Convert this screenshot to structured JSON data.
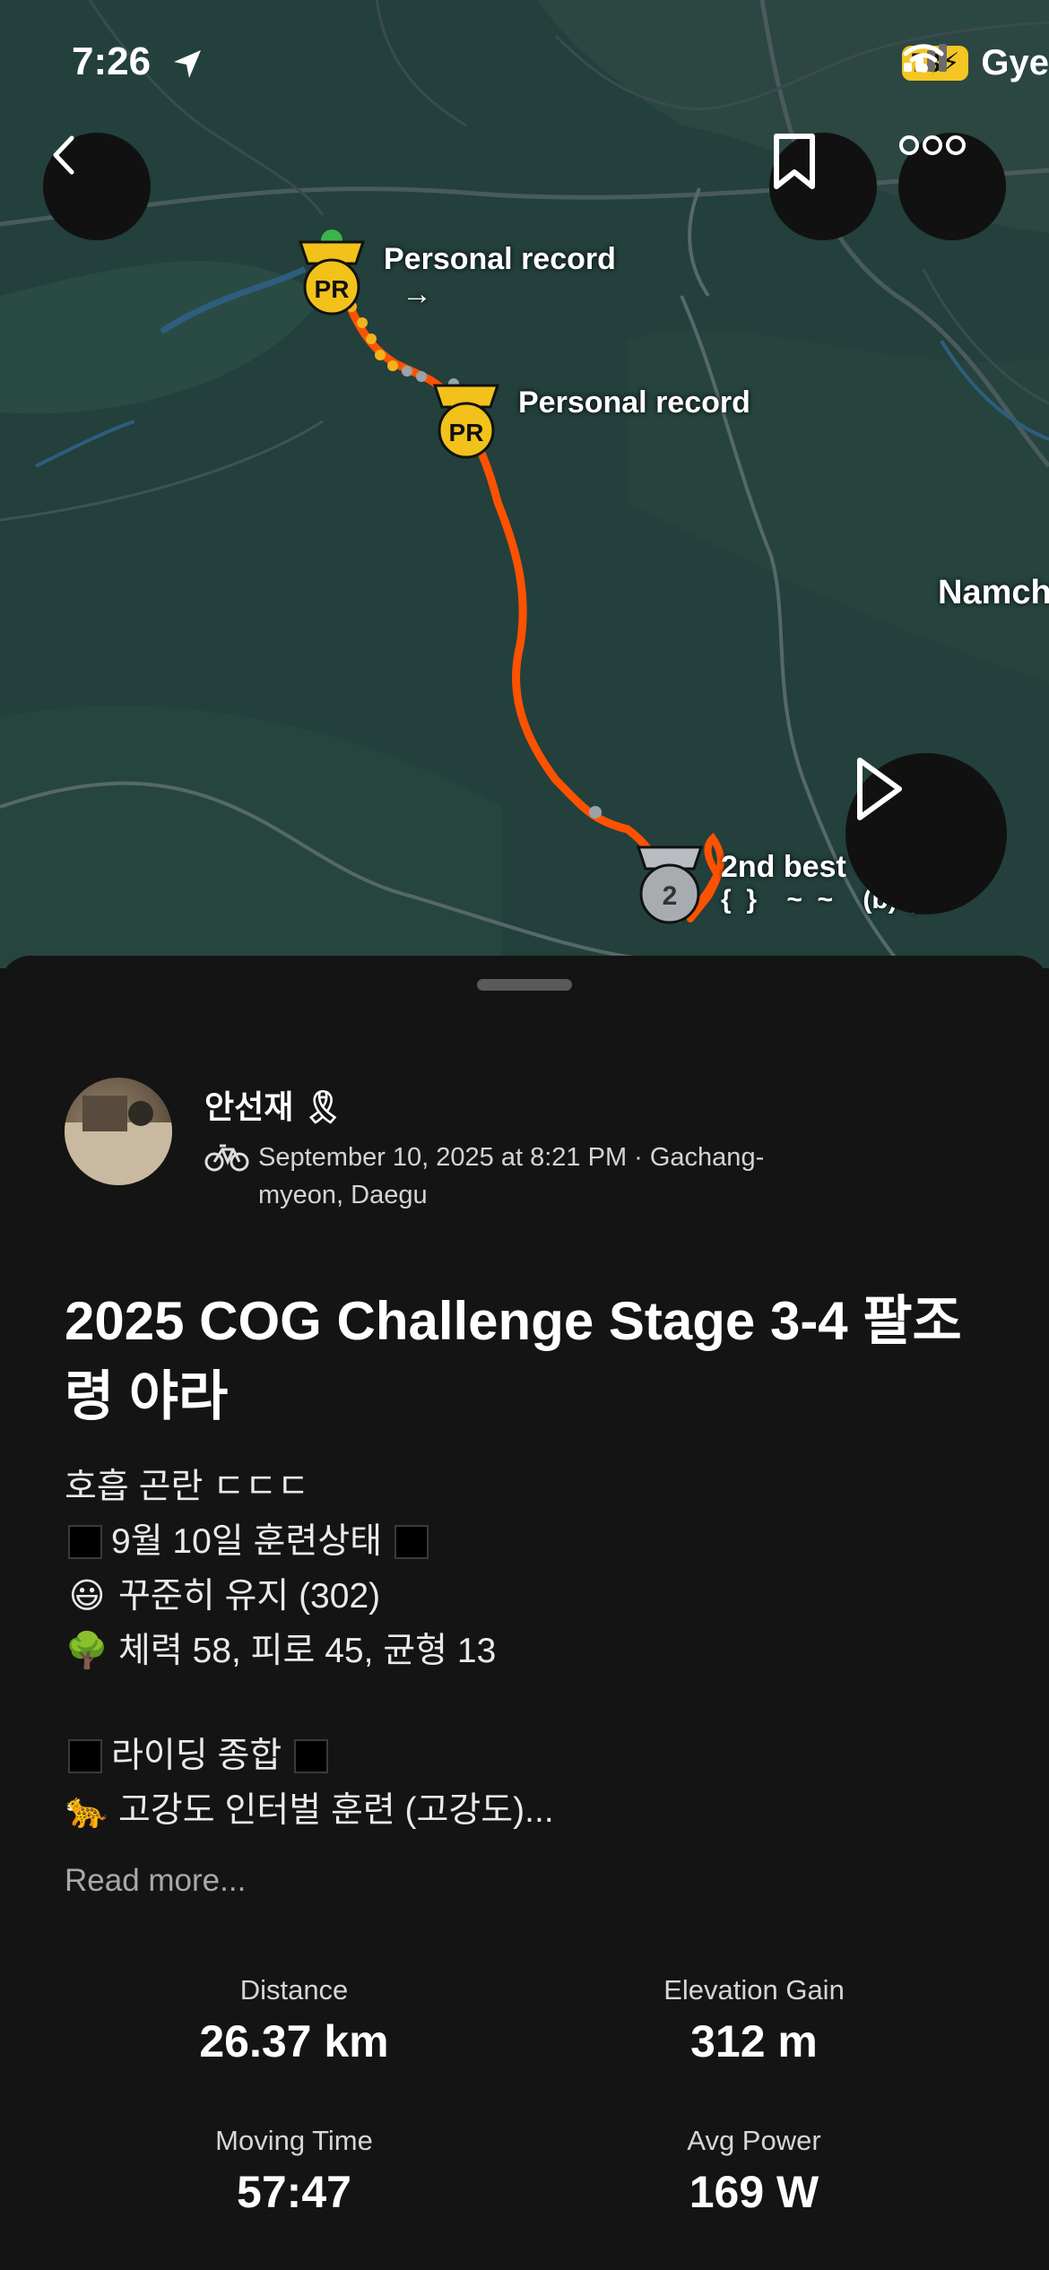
{
  "status_bar": {
    "time": "7:26",
    "battery": "73",
    "map_label_top_right": "Gye"
  },
  "map": {
    "place_label": "Namch",
    "markers": [
      {
        "badge": "PR",
        "label": "Personal record",
        "sublabel": "→"
      },
      {
        "badge": "PR",
        "label": "Personal record"
      },
      {
        "badge": "2",
        "label": "2nd best",
        "sublabel": "{  }    ~  ~    (b)  )"
      }
    ]
  },
  "activity": {
    "user_name": "안선재 🎗",
    "meta": "September 10, 2025 at 8:21 PM · Gachang-myeon, Daegu",
    "title": "2025 COG Challenge Stage 3-4 팔조령 야라",
    "description": {
      "line1": "호흡 곤란 ㄷㄷㄷ",
      "line2": "9월 10일 훈련상태",
      "line3_emoji": "😃",
      "line3": "꾸준히 유지 (302)",
      "line4_emoji": "🌳",
      "line4": "체력 58, 피로 45, 균형 13",
      "line5": "라이딩 종합",
      "line6_emoji": "🐆",
      "line6": "고강도 인터벌 훈련 (고강도)..."
    },
    "read_more": "Read more...",
    "stats": [
      {
        "label": "Distance",
        "value": "26.37 km"
      },
      {
        "label": "Elevation Gain",
        "value": "312 m"
      },
      {
        "label": "Moving Time",
        "value": "57:47"
      },
      {
        "label": "Avg Power",
        "value": "169 W"
      }
    ]
  }
}
